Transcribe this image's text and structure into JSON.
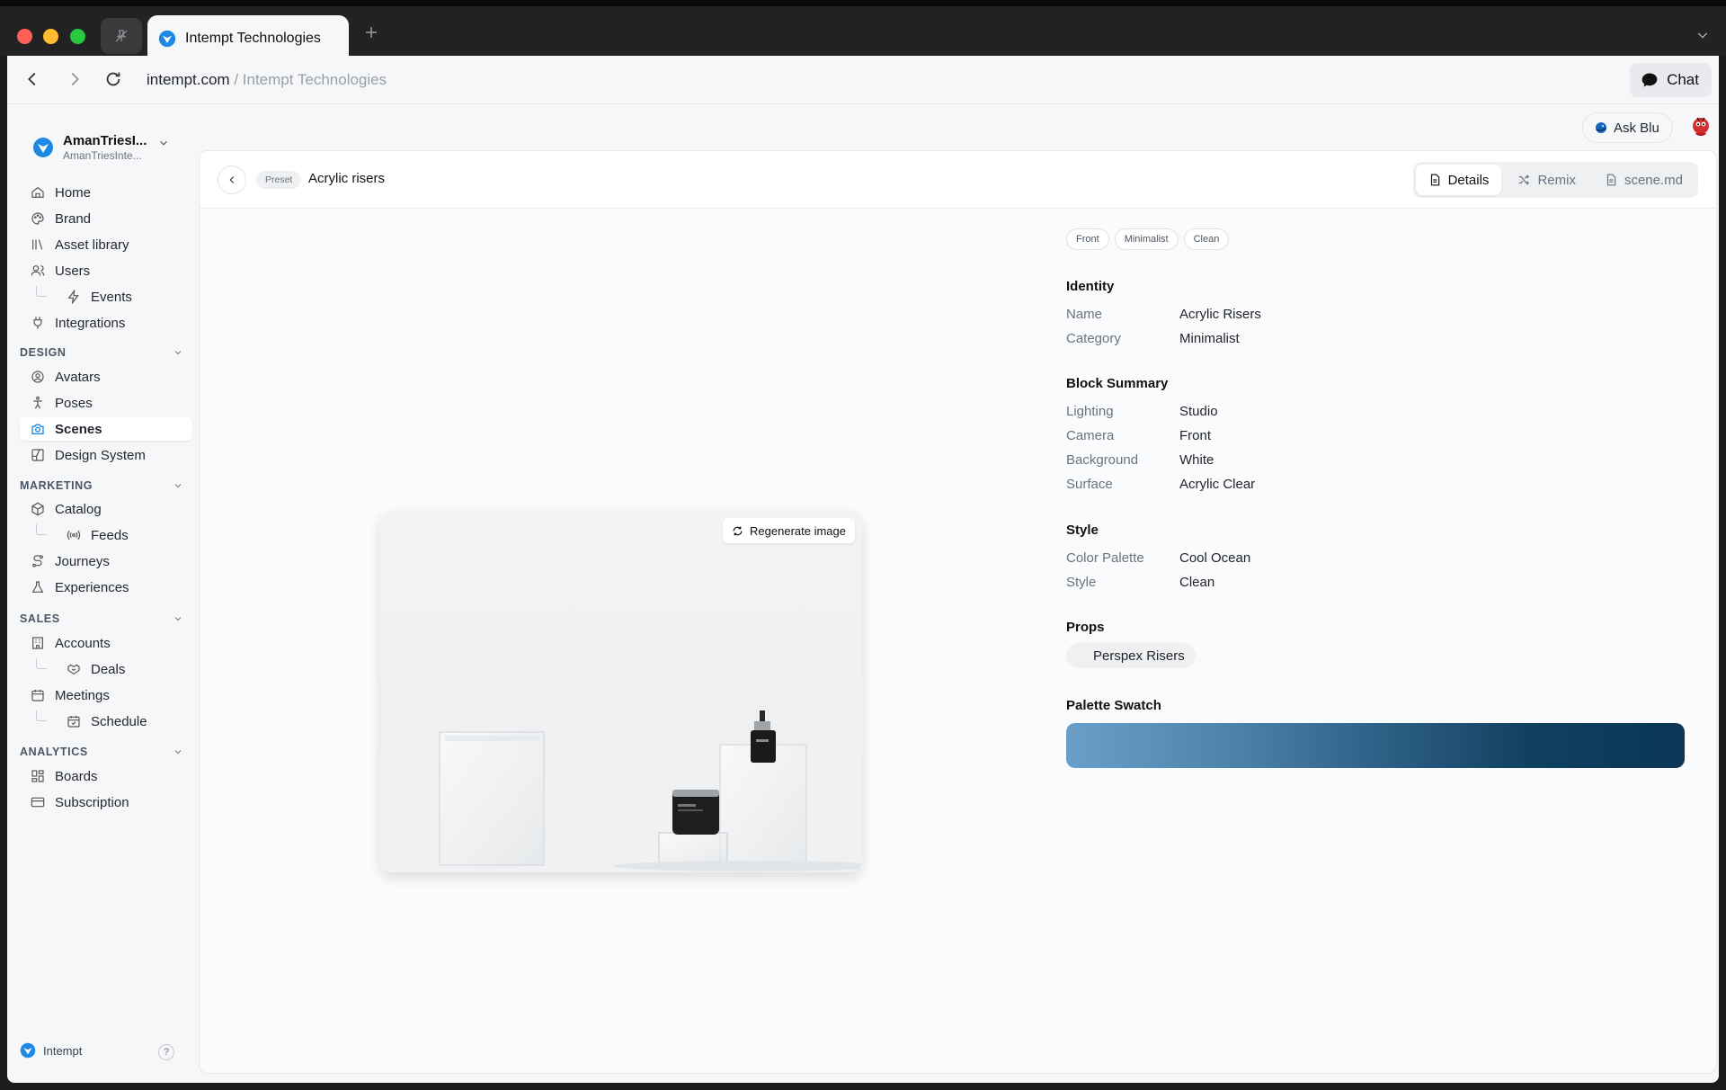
{
  "browser": {
    "tab_title": "Intempt Technologies",
    "url_host": "intempt.com",
    "url_path": " / Intempt Technologies",
    "chat_label": "Chat"
  },
  "workspace": {
    "name": "AmanTriesI...",
    "subtitle": "AmanTriesInte..."
  },
  "nav": {
    "home": "Home",
    "brand": "Brand",
    "asset_library": "Asset library",
    "users": "Users",
    "events": "Events",
    "integrations": "Integrations",
    "design_section": "DESIGN",
    "avatars": "Avatars",
    "poses": "Poses",
    "scenes": "Scenes",
    "design_system": "Design System",
    "marketing_section": "MARKETING",
    "catalog": "Catalog",
    "feeds": "Feeds",
    "journeys": "Journeys",
    "experiences": "Experiences",
    "sales_section": "SALES",
    "accounts": "Accounts",
    "deals": "Deals",
    "meetings": "Meetings",
    "schedule": "Schedule",
    "analytics_section": "ANALYTICS",
    "boards": "Boards",
    "subscription": "Subscription"
  },
  "footer": {
    "brand": "Intempt",
    "help": "?"
  },
  "topbar": {
    "ask_blu": "Ask Blu"
  },
  "header": {
    "preset_chip": "Preset",
    "title": "Acrylic risers",
    "tabs": {
      "details": "Details",
      "remix": "Remix",
      "scene_md": "scene.md"
    }
  },
  "image": {
    "regenerate_label": "Regenerate image"
  },
  "details": {
    "tags": [
      "Front",
      "Minimalist",
      "Clean"
    ],
    "identity": {
      "title": "Identity",
      "name_key": "Name",
      "name_val": "Acrylic Risers",
      "category_key": "Category",
      "category_val": "Minimalist"
    },
    "block_summary": {
      "title": "Block Summary",
      "lighting_key": "Lighting",
      "lighting_val": "Studio",
      "camera_key": "Camera",
      "camera_val": "Front",
      "background_key": "Background",
      "background_val": "White",
      "surface_key": "Surface",
      "surface_val": "Acrylic Clear"
    },
    "style": {
      "title": "Style",
      "palette_key": "Color Palette",
      "palette_val": "Cool Ocean",
      "style_key": "Style",
      "style_val": "Clean"
    },
    "props": {
      "title": "Props",
      "item": "Perspex Risers"
    },
    "palette_swatch": {
      "title": "Palette Swatch",
      "colors": [
        "#6a9fc9",
        "#4f85ad",
        "#2f6188",
        "#11405f",
        "#0b3656"
      ]
    }
  },
  "colors": {
    "accent": "#1e88e5",
    "active_nav_icon": "#1e88e5"
  }
}
